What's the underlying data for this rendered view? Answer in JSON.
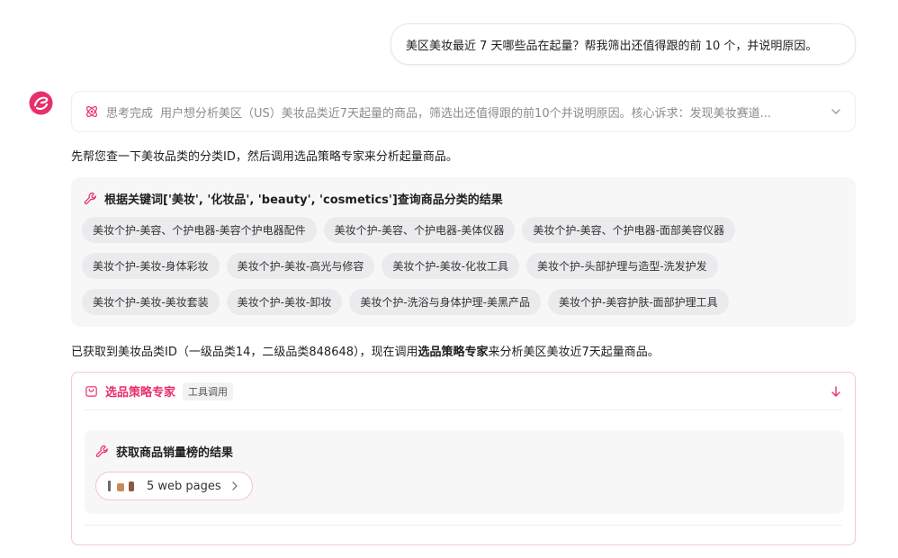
{
  "user_message": "美区美妆最近 7 天哪些品在起量？帮我筛出还值得跟的前 10 个，并说明原因。",
  "thinking": {
    "status": "思考完成",
    "summary": "用户想分析美区（US）美妆品类近7天起量的商品，筛选出还值得跟的前10个并说明原因。核心诉求：发现美妆赛道..."
  },
  "intro_text": "先帮您查一下美妆品类的分类ID，然后调用选品策略专家来分析起量商品。",
  "category_tool": {
    "title": "根据关键词['美妆', '化妆品', 'beauty', 'cosmetics']查询商品分类的结果",
    "tags": [
      "美妆个护-美容、个护电器-美容个护电器配件",
      "美妆个护-美容、个护电器-美体仪器",
      "美妆个护-美容、个护电器-面部美容仪器",
      "美妆个护-美妆-身体彩妆",
      "美妆个护-美妆-高光与修容",
      "美妆个护-美妆-化妆工具",
      "美妆个护-头部护理与造型-洗发护发",
      "美妆个护-美妆-美妆套装",
      "美妆个护-美妆-卸妆",
      "美妆个护-洗浴与身体护理-美黑产品",
      "美妆个护-美容护肤-面部护理工具"
    ]
  },
  "status_text": {
    "before": "已获取到美妆品类ID（一级品类14，二级品类848648），现在调用",
    "bold": "选品策略专家",
    "after": "来分析美区美妆近7天起量商品。"
  },
  "expert": {
    "name": "选品策略专家",
    "badge": "工具调用",
    "sales_title": "获取商品销量榜的结果",
    "web_pages": "5 web pages"
  },
  "colors": {
    "accent": "#e8306a",
    "card_bg": "#f7f7f8",
    "tag_bg": "#ebebed"
  }
}
